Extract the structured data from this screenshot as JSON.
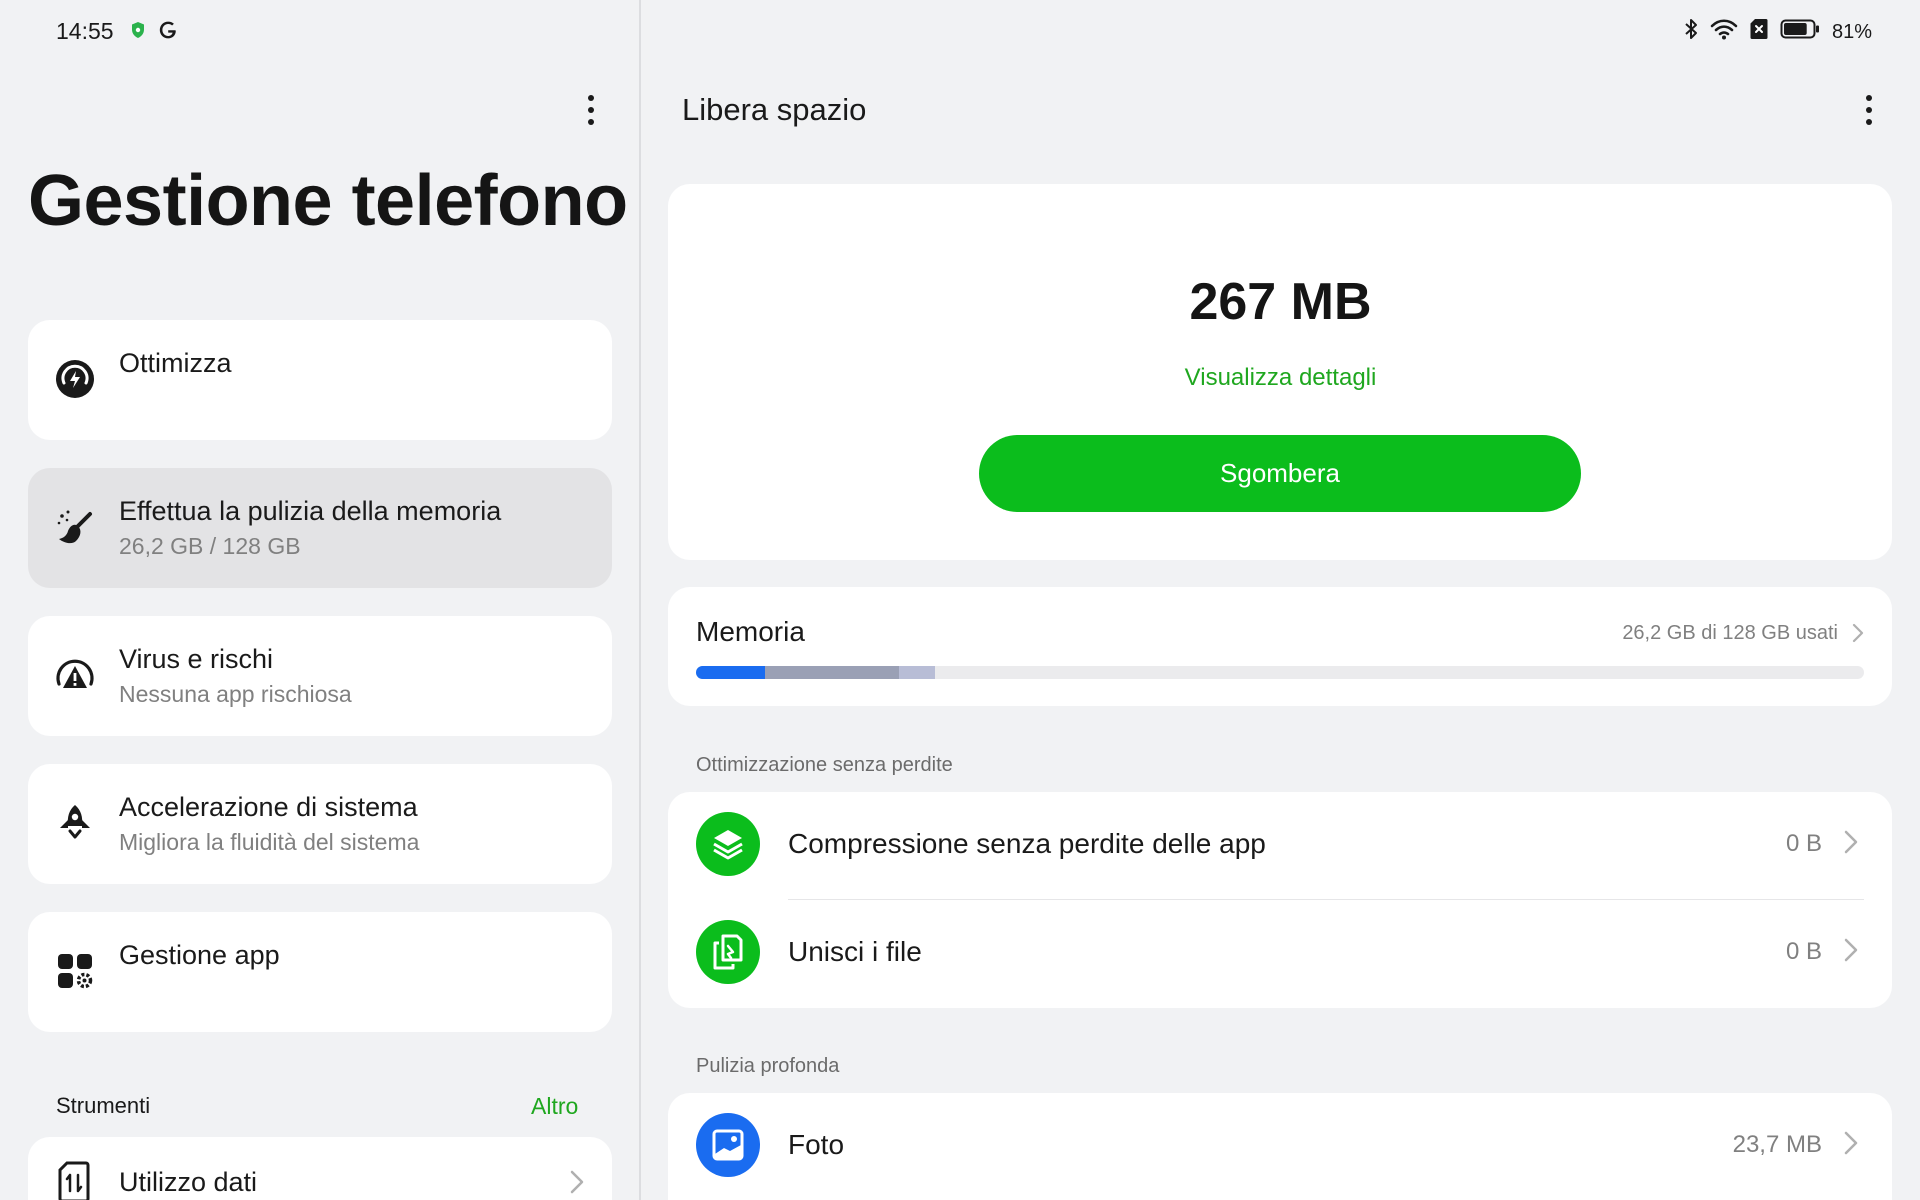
{
  "status": {
    "time": "14:55",
    "battery": "81%",
    "battery_level": 0.81
  },
  "left": {
    "app_title": "Gestione telefono",
    "cards": [
      {
        "title": "Ottimizza",
        "subtitle": ""
      },
      {
        "title": "Effettua la pulizia della memoria",
        "subtitle": "26,2 GB / 128 GB"
      },
      {
        "title": "Virus e rischi",
        "subtitle": "Nessuna app rischiosa"
      },
      {
        "title": "Accelerazione di sistema",
        "subtitle": "Migliora la fluidità del sistema"
      },
      {
        "title": "Gestione app",
        "subtitle": ""
      }
    ],
    "tools_label": "Strumenti",
    "tools_more": "Altro",
    "data_usage": "Utilizzo dati"
  },
  "right": {
    "title": "Libera spazio",
    "junk_size": "267 MB",
    "details_link": "Visualizza dettagli",
    "clean_button": "Sgombera",
    "memory": {
      "title": "Memoria",
      "used_text": "26,2 GB di 128 GB usati",
      "segments": [
        {
          "fraction": 0.059,
          "color": "#1a6cf0"
        },
        {
          "fraction": 0.115,
          "color": "#9aa0b5"
        },
        {
          "fraction": 0.031,
          "color": "#b8bdd6"
        }
      ]
    },
    "lossless_section": "Ottimizzazione senza perdite",
    "lossless_items": [
      {
        "label": "Compressione senza perdite delle app",
        "value": "0 B"
      },
      {
        "label": "Unisci i file",
        "value": "0 B"
      }
    ],
    "deep_section": "Pulizia profonda",
    "deep_items": [
      {
        "label": "Foto",
        "value": "23,7 MB"
      }
    ]
  },
  "colors": {
    "accent_green": "#0bbd1c",
    "link_green": "#1fa71f",
    "blue": "#1a6cf0"
  }
}
